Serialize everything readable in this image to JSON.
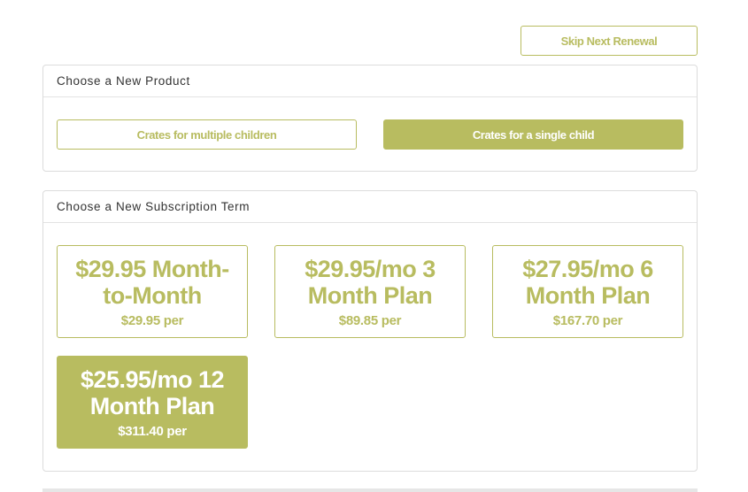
{
  "skip_button": {
    "label": "Skip Next Renewal"
  },
  "product_section": {
    "heading": "Choose a New Product",
    "options": [
      {
        "label": "Crates for multiple children",
        "selected": false
      },
      {
        "label": "Crates for a single child",
        "selected": true
      }
    ]
  },
  "term_section": {
    "heading": "Choose a New Subscription Term",
    "plans": [
      {
        "title": "$29.95 Month-to-Month",
        "price": "$29.95 per",
        "selected": false
      },
      {
        "title": "$29.95/mo 3 Month Plan",
        "price": "$89.85 per",
        "selected": false
      },
      {
        "title": "$27.95/mo 6 Month Plan",
        "price": "$167.70 per",
        "selected": false
      },
      {
        "title": "$25.95/mo 12 Month Plan",
        "price": "$311.40 per",
        "selected": true
      }
    ]
  },
  "colors": {
    "accent": "#b8bc60",
    "border": "#dcdcdc",
    "text": "#333333"
  }
}
